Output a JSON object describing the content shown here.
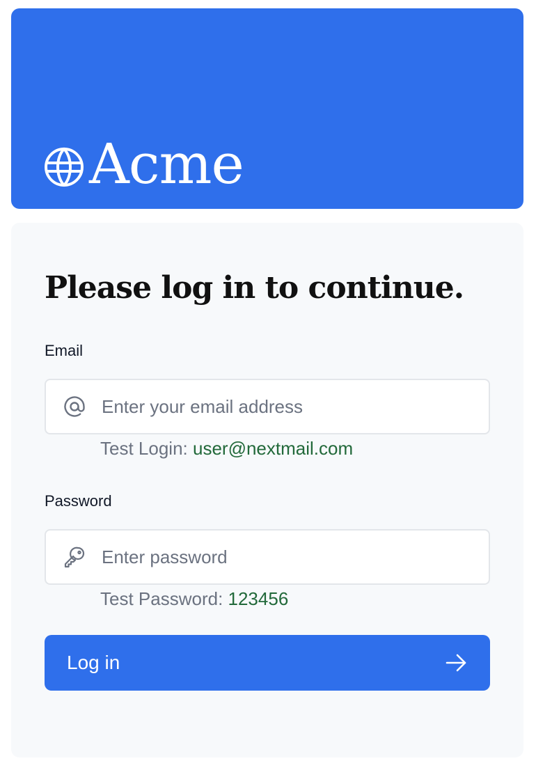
{
  "brand": {
    "name": "Acme",
    "icon": "globe-icon",
    "color": "#2f6feb"
  },
  "login": {
    "heading": "Please log in to continue.",
    "email": {
      "label": "Email",
      "placeholder": "Enter your email address",
      "value": "",
      "icon": "at-sign-icon",
      "hint_prefix": "Test Login: ",
      "hint_value": "user@nextmail.com"
    },
    "password": {
      "label": "Password",
      "placeholder": "Enter password",
      "value": "",
      "icon": "key-icon",
      "hint_prefix": "Test Password: ",
      "hint_value": "123456"
    },
    "submit": {
      "label": "Log in",
      "icon": "arrow-right-icon"
    }
  },
  "colors": {
    "accent": "#2f6feb",
    "card_background": "#f7f9fb",
    "hint_value": "#22693a",
    "muted_text": "#6b7280"
  }
}
